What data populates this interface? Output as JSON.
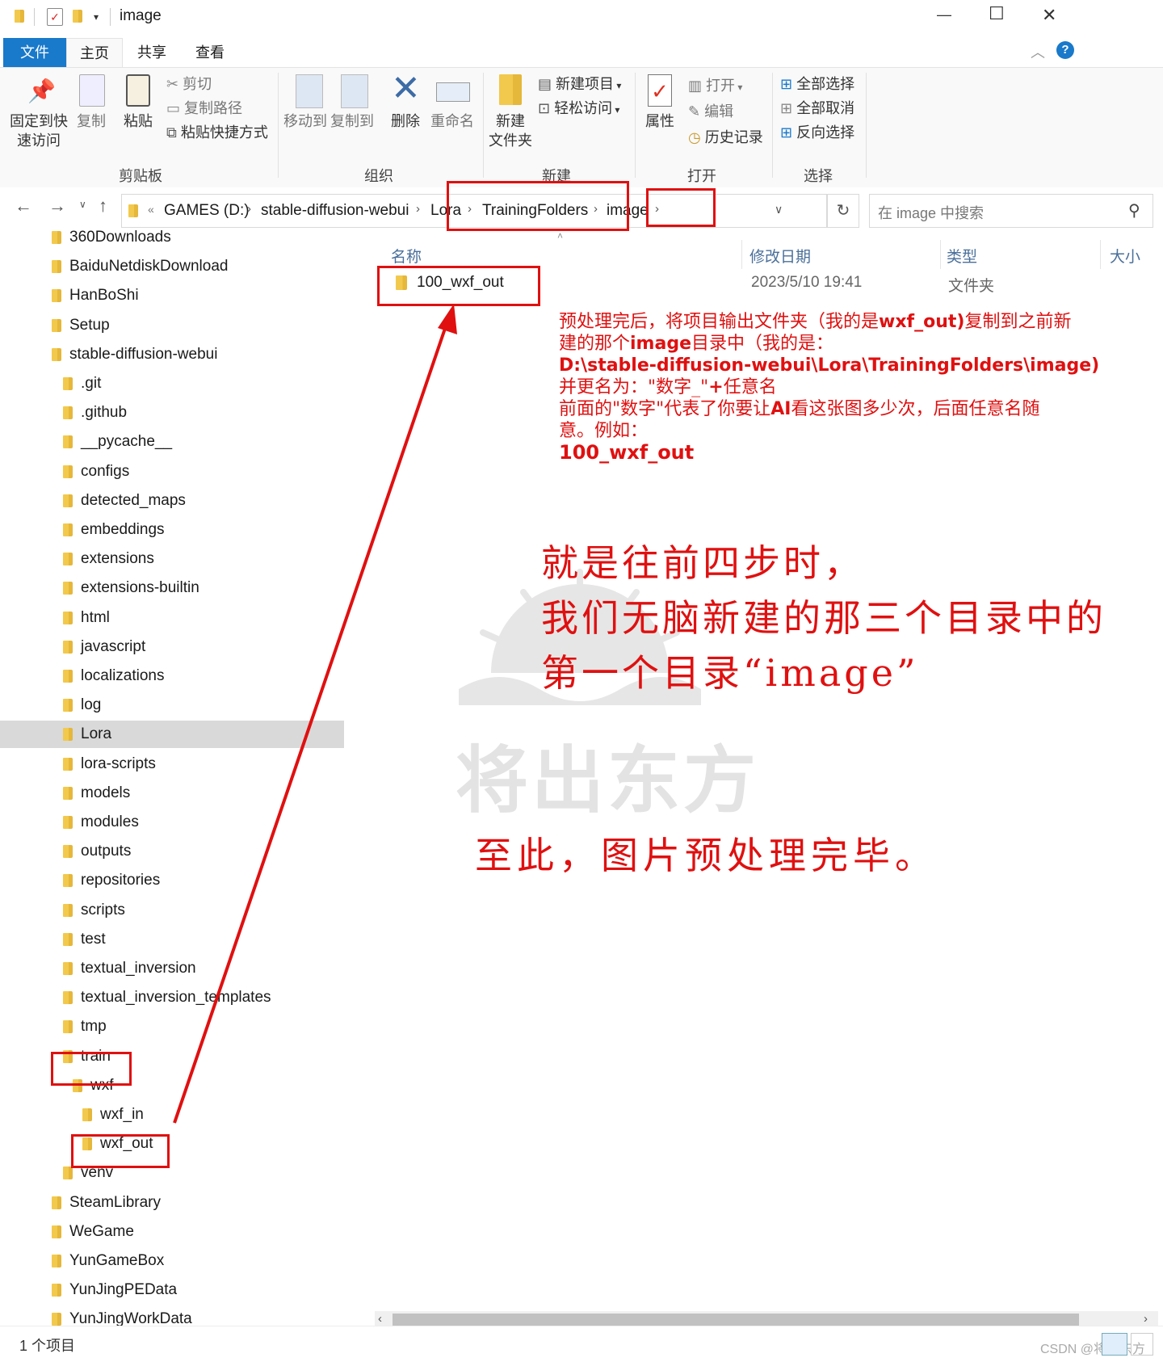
{
  "window": {
    "title": "image",
    "controls": {
      "minimize": "—",
      "maximize": "☐",
      "close": "✕"
    }
  },
  "ribbon_tabs": [
    "文件",
    "主页",
    "共享",
    "查看"
  ],
  "ribbon": {
    "clipboard": {
      "pin_label_1": "固定到快",
      "pin_label_2": "速访问",
      "copy": "复制",
      "paste": "粘贴",
      "cut": "剪切",
      "copy_path": "复制路径",
      "paste_shortcut": "粘贴快捷方式",
      "group": "剪贴板"
    },
    "organize": {
      "move_to": "移动到",
      "copy_to": "复制到",
      "delete": "删除",
      "rename": "重命名",
      "group": "组织"
    },
    "new": {
      "new_folder_1": "新建",
      "new_folder_2": "文件夹",
      "new_item": "新建项目",
      "easy_access": "轻松访问",
      "group": "新建"
    },
    "open": {
      "properties": "属性",
      "open": "打开",
      "edit": "编辑",
      "history": "历史记录",
      "group": "打开"
    },
    "select": {
      "select_all": "全部选择",
      "select_none": "全部取消",
      "invert": "反向选择",
      "group": "选择"
    }
  },
  "address": {
    "overflow": "«",
    "crumbs": [
      "GAMES (D:)",
      "stable-diffusion-webui",
      "Lora",
      "TrainingFolders",
      "image"
    ],
    "search_placeholder": "在 image 中搜索"
  },
  "nav_tree": [
    {
      "label": "360Downloads",
      "indent": 0
    },
    {
      "label": "BaiduNetdiskDownload",
      "indent": 0
    },
    {
      "label": "HanBoShi",
      "indent": 0
    },
    {
      "label": "Setup",
      "indent": 0
    },
    {
      "label": "stable-diffusion-webui",
      "indent": 0
    },
    {
      "label": ".git",
      "indent": 1
    },
    {
      "label": ".github",
      "indent": 1
    },
    {
      "label": "__pycache__",
      "indent": 1
    },
    {
      "label": "configs",
      "indent": 1
    },
    {
      "label": "detected_maps",
      "indent": 1
    },
    {
      "label": "embeddings",
      "indent": 1
    },
    {
      "label": "extensions",
      "indent": 1
    },
    {
      "label": "extensions-builtin",
      "indent": 1
    },
    {
      "label": "html",
      "indent": 1
    },
    {
      "label": "javascript",
      "indent": 1
    },
    {
      "label": "localizations",
      "indent": 1
    },
    {
      "label": "log",
      "indent": 1
    },
    {
      "label": "Lora",
      "indent": 1,
      "selected": true
    },
    {
      "label": "lora-scripts",
      "indent": 1
    },
    {
      "label": "models",
      "indent": 1
    },
    {
      "label": "modules",
      "indent": 1
    },
    {
      "label": "outputs",
      "indent": 1
    },
    {
      "label": "repositories",
      "indent": 1
    },
    {
      "label": "scripts",
      "indent": 1
    },
    {
      "label": "test",
      "indent": 1
    },
    {
      "label": "textual_inversion",
      "indent": 1
    },
    {
      "label": "textual_inversion_templates",
      "indent": 1
    },
    {
      "label": "tmp",
      "indent": 1
    },
    {
      "label": "train",
      "indent": 1
    },
    {
      "label": "wxf",
      "indent": 2
    },
    {
      "label": "wxf_in",
      "indent": 3
    },
    {
      "label": "wxf_out",
      "indent": 3
    },
    {
      "label": "venv",
      "indent": 1
    },
    {
      "label": "SteamLibrary",
      "indent": 0
    },
    {
      "label": "WeGame",
      "indent": 0
    },
    {
      "label": "YunGameBox",
      "indent": 0
    },
    {
      "label": "YunJingPEData",
      "indent": 0
    },
    {
      "label": "YunJingWorkData",
      "indent": 0
    }
  ],
  "columns": [
    "名称",
    "修改日期",
    "类型",
    "大小"
  ],
  "files": [
    {
      "name": "100_wxf_out",
      "date": "2023/5/10 19:41",
      "type": "文件夹",
      "size": ""
    }
  ],
  "annotation_small": {
    "line1a": "预处理完后，将项目输出文件夹（我的是",
    "line1b": "wxf_out)",
    "line1c": "复制到之前新",
    "line2a": "建的那个",
    "line2b": "image",
    "line2c": "目录中（我的是：",
    "line3": "D:\\stable-diffusion-webui\\Lora\\TrainingFolders\\image)",
    "line4a": "并更名为：\"数字_\"",
    "line4b": "+",
    "line4c": "任意名",
    "line5a": "前面的\"数字\"代表了你要让",
    "line5b": "AI",
    "line5c": "看这张图多少次，后面任意名随",
    "line6": "意。例如：",
    "line7": "100_wxf_out"
  },
  "annotation_big": {
    "line1": "就是往前四步时，",
    "line2": "我们无脑新建的那三个目录中的",
    "line3": "第一个目录“image”",
    "line4": "至此，图片预处理完毕。"
  },
  "watermark": {
    "text": "将出东方",
    "csdn": "CSDN @将出东方"
  },
  "status": {
    "count": "1 个项目"
  },
  "colors": {
    "accent": "#1979ca",
    "annotation": "#e01010",
    "folder": "#f2c94c",
    "selected": "#d9d9d9"
  }
}
